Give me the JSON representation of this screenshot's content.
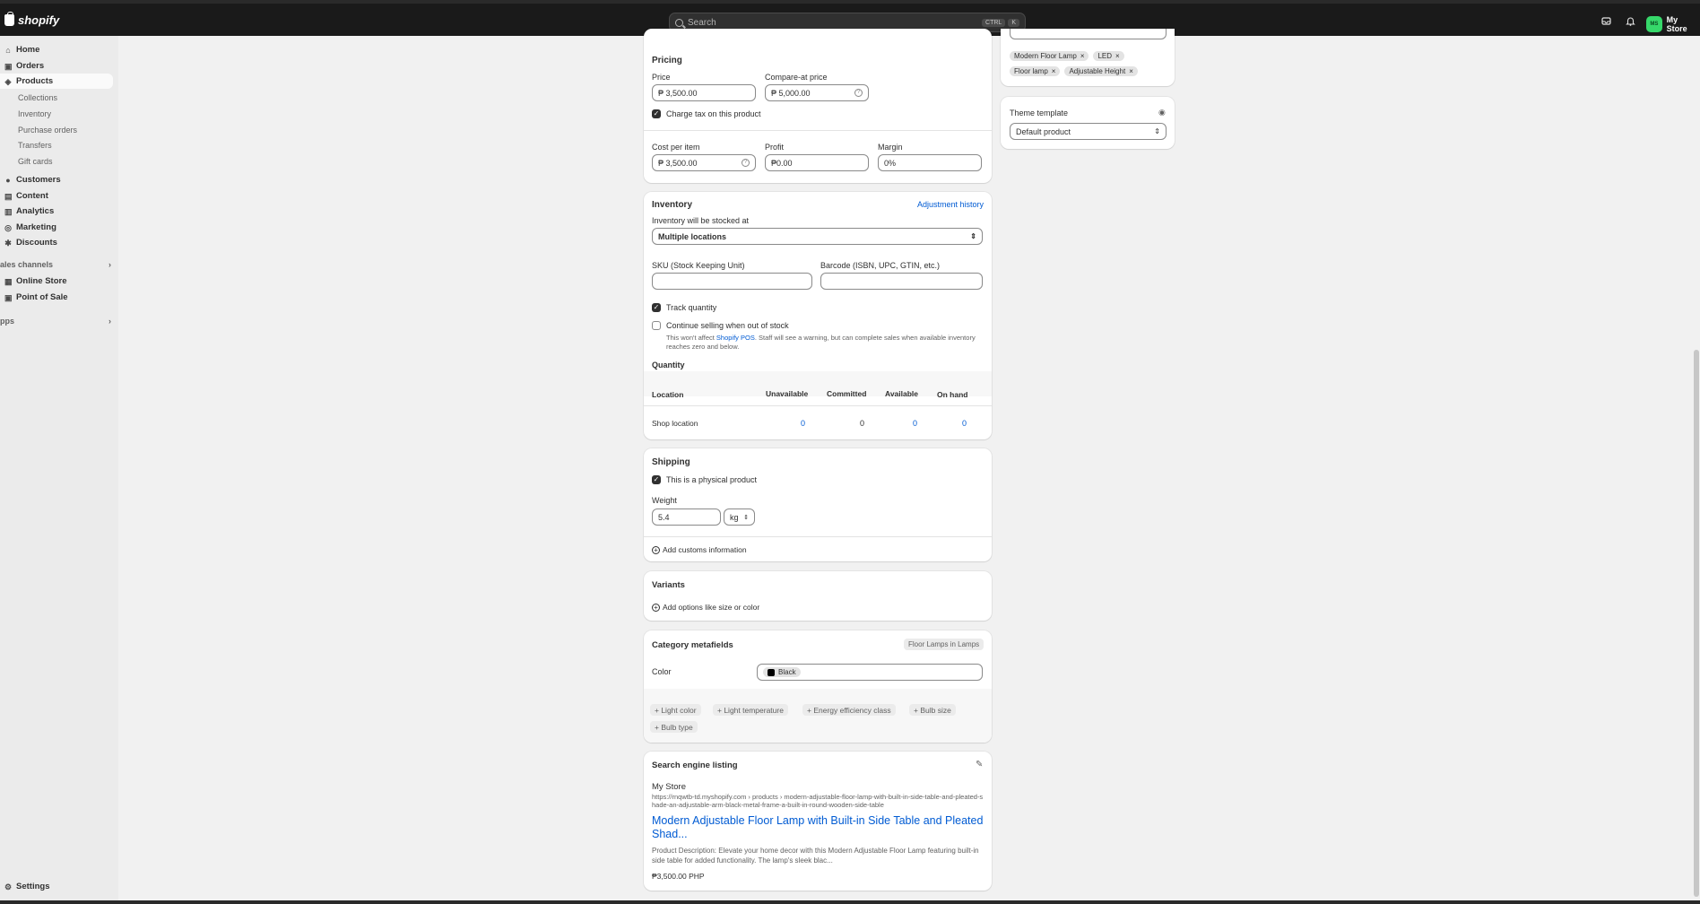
{
  "topbar": {
    "logo_text": "shopify",
    "search_placeholder": "Search",
    "shortcut_key1": "CTRL",
    "shortcut_key2": "K",
    "avatar_initials": "MS",
    "store_name": "My Store"
  },
  "sidebar": {
    "home": "Home",
    "orders": "Orders",
    "products": "Products",
    "collections": "Collections",
    "inventory": "Inventory",
    "purchase_orders": "Purchase orders",
    "transfers": "Transfers",
    "gift_cards": "Gift cards",
    "customers": "Customers",
    "content": "Content",
    "analytics": "Analytics",
    "marketing": "Marketing",
    "discounts": "Discounts",
    "sales_channels": "ales channels",
    "online_store": "Online Store",
    "point_of_sale": "Point of Sale",
    "apps": "pps",
    "settings": "Settings"
  },
  "pricing": {
    "title": "Pricing",
    "price_label": "Price",
    "price_value": "₱ 3,500.00",
    "compare_label": "Compare-at price",
    "compare_value": "₱ 5,000.00",
    "charge_tax_label": "Charge tax on this product",
    "cost_label": "Cost per item",
    "cost_value": "₱ 3,500.00",
    "profit_label": "Profit",
    "profit_value": "₱0.00",
    "margin_label": "Margin",
    "margin_value": "0%"
  },
  "inventory": {
    "title": "Inventory",
    "adjustment_link": "Adjustment history",
    "stocked_label": "Inventory will be stocked at",
    "stocked_value": "Multiple locations",
    "sku_label": "SKU (Stock Keeping Unit)",
    "barcode_label": "Barcode (ISBN, UPC, GTIN, etc.)",
    "track_label": "Track quantity",
    "continue_label": "Continue selling when out of stock",
    "note_before": "This won't affect ",
    "note_link": "Shopify POS",
    "note_after": ". Staff will see a warning, but can complete sales when available inventory reaches zero and below.",
    "quantity_title": "Quantity",
    "table_headers": [
      "Location",
      "Unavailable",
      "Committed",
      "Available",
      "On hand"
    ],
    "row": {
      "location": "Shop location",
      "unavailable": "0",
      "committed": "0",
      "available": "0",
      "on_hand": "0"
    }
  },
  "shipping": {
    "title": "Shipping",
    "physical_label": "This is a physical product",
    "weight_label": "Weight",
    "weight_value": "5.4",
    "weight_unit": "kg",
    "customs_link": "Add customs information"
  },
  "variants": {
    "title": "Variants",
    "add_options": "Add options like size or color"
  },
  "category_metafields": {
    "title": "Category metafields",
    "category_badge": "Floor Lamps in Lamps",
    "color_label": "Color",
    "color_value": "Black",
    "chips": [
      "+ Light color",
      "+ Light temperature",
      "+ Energy efficiency class",
      "+ Bulb size",
      "+ Bulb type"
    ]
  },
  "seo": {
    "title": "Search engine listing",
    "store_name": "My Store",
    "url": "https://rnqwtb-td.myshopify.com › products › modern-adjustable-floor-lamp-with-built-in-side-table-and-pleated-shade-an-adjustable-arm-black-metal-frame-a-built-in-round-wooden-side-table",
    "heading": "Modern Adjustable Floor Lamp with Built-in Side Table and Pleated Shad...",
    "description": "Product Description: Elevate your home decor with this Modern Adjustable Floor Lamp featuring built-in side table for added functionality. The lamp's sleek blac...",
    "price": "₱3,500.00 PHP"
  },
  "tags_card": {
    "tags": [
      "Modern Floor Lamp",
      "LED",
      "Floor lamp",
      "Adjustable Height"
    ]
  },
  "theme_template": {
    "title": "Theme template",
    "value": "Default product"
  }
}
